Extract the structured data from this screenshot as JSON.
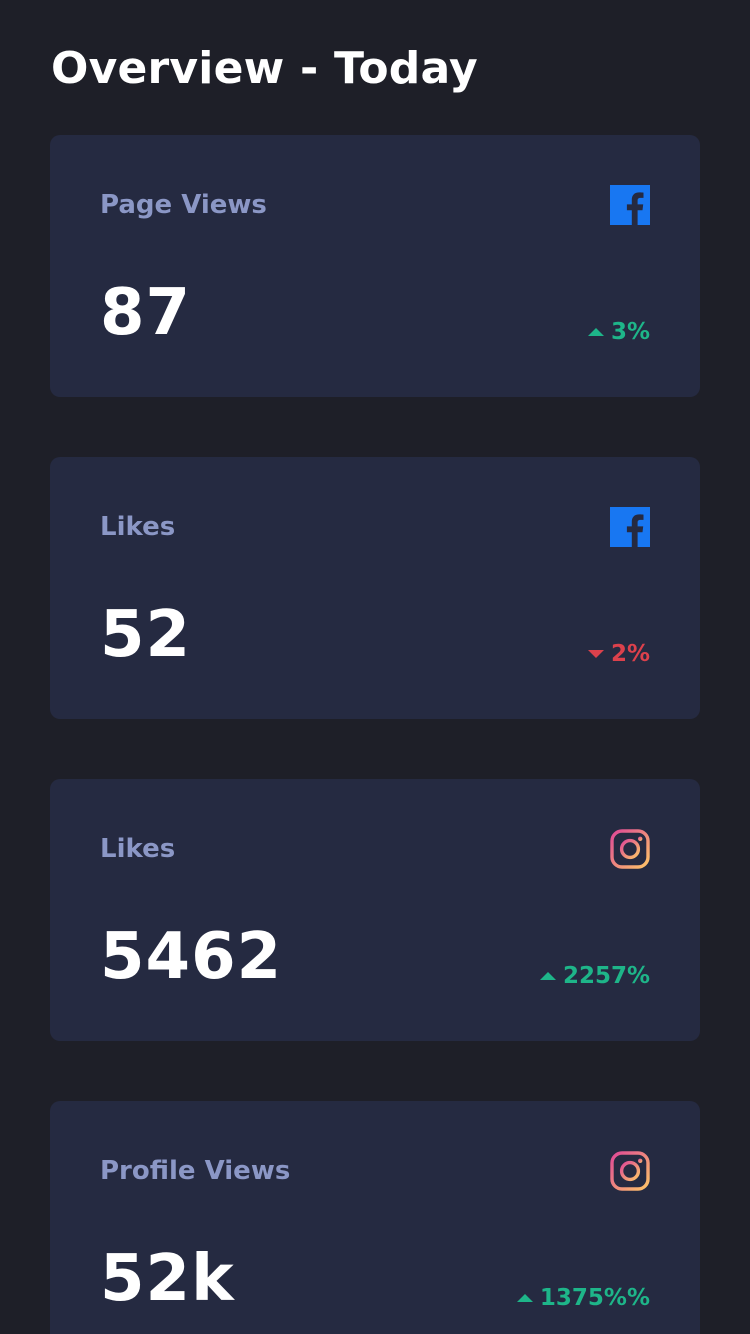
{
  "header": {
    "title": "Overview - Today"
  },
  "colors": {
    "background": "#1e1f28",
    "card_background": "#252a41",
    "label": "#8b97c6",
    "up": "#1eb589",
    "down": "#dc414c",
    "facebook": "#1877f2"
  },
  "cards": [
    {
      "label": "Page Views",
      "value": "87",
      "change": "3%",
      "direction": "up",
      "icon": "facebook-icon"
    },
    {
      "label": "Likes",
      "value": "52",
      "change": "2%",
      "direction": "down",
      "icon": "facebook-icon"
    },
    {
      "label": "Likes",
      "value": "5462",
      "change": "2257%",
      "direction": "up",
      "icon": "instagram-icon"
    },
    {
      "label": "Profile Views",
      "value": "52k",
      "change": "1375%%",
      "direction": "up",
      "icon": "instagram-icon"
    }
  ]
}
